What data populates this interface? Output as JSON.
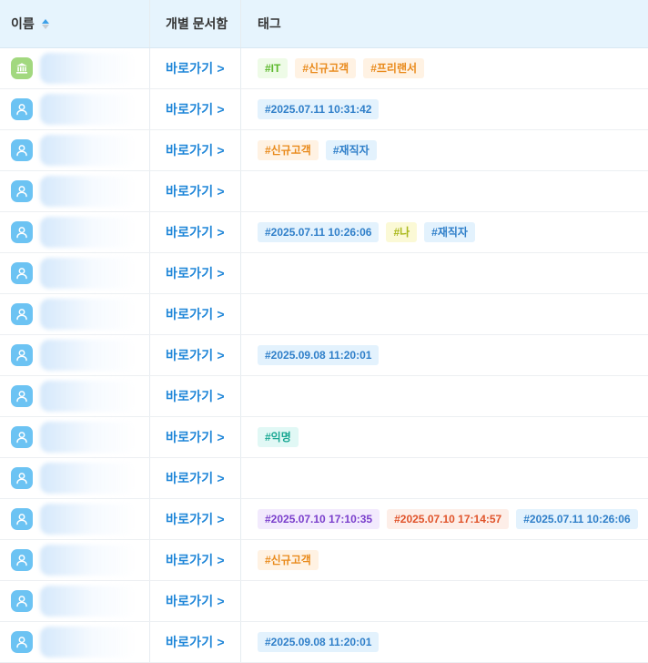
{
  "header": {
    "name": "이름",
    "doc": "개별 문서함",
    "tags": "태그"
  },
  "colors": {
    "accent": "#1f86d8",
    "header_bg": "#e6f4fd",
    "avatar_person": "#6cc3f3",
    "avatar_org": "#a2d87f"
  },
  "rows": [
    {
      "avatar": "bank-icon",
      "link": "바로가기 >",
      "tags": [
        {
          "text": "#IT",
          "color": "green"
        },
        {
          "text": "#신규고객",
          "color": "orange"
        },
        {
          "text": "#프리랜서",
          "color": "orange"
        }
      ]
    },
    {
      "avatar": "user-icon",
      "link": "바로가기 >",
      "tags": [
        {
          "text": "#2025.07.11 10:31:42",
          "color": "blue"
        }
      ]
    },
    {
      "avatar": "user-icon",
      "link": "바로가기 >",
      "tags": [
        {
          "text": "#신규고객",
          "color": "orange"
        },
        {
          "text": "#재직자",
          "color": "blue"
        }
      ]
    },
    {
      "avatar": "user-icon",
      "link": "바로가기 >",
      "tags": []
    },
    {
      "avatar": "user-icon",
      "link": "바로가기 >",
      "tags": [
        {
          "text": "#2025.07.11 10:26:06",
          "color": "blue"
        },
        {
          "text": "#나",
          "color": "yellow"
        },
        {
          "text": "#재직자",
          "color": "blue"
        }
      ]
    },
    {
      "avatar": "user-icon",
      "link": "바로가기 >",
      "tags": []
    },
    {
      "avatar": "user-icon",
      "link": "바로가기 >",
      "tags": []
    },
    {
      "avatar": "user-icon",
      "link": "바로가기 >",
      "tags": [
        {
          "text": "#2025.09.08 11:20:01",
          "color": "blue"
        }
      ]
    },
    {
      "avatar": "user-icon",
      "link": "바로가기 >",
      "tags": []
    },
    {
      "avatar": "user-icon",
      "link": "바로가기 >",
      "tags": [
        {
          "text": "#익명",
          "color": "teal"
        }
      ]
    },
    {
      "avatar": "user-icon",
      "link": "바로가기 >",
      "tags": []
    },
    {
      "avatar": "user-icon",
      "link": "바로가기 >",
      "tags": [
        {
          "text": "#2025.07.10 17:10:35",
          "color": "purple"
        },
        {
          "text": "#2025.07.10 17:14:57",
          "color": "red"
        },
        {
          "text": "#2025.07.11 10:26:06",
          "color": "blue"
        }
      ]
    },
    {
      "avatar": "user-icon",
      "link": "바로가기 >",
      "tags": [
        {
          "text": "#신규고객",
          "color": "orange"
        }
      ]
    },
    {
      "avatar": "user-icon",
      "link": "바로가기 >",
      "tags": []
    },
    {
      "avatar": "user-icon",
      "link": "바로가기 >",
      "tags": [
        {
          "text": "#2025.09.08 11:20:01",
          "color": "blue"
        }
      ]
    }
  ]
}
